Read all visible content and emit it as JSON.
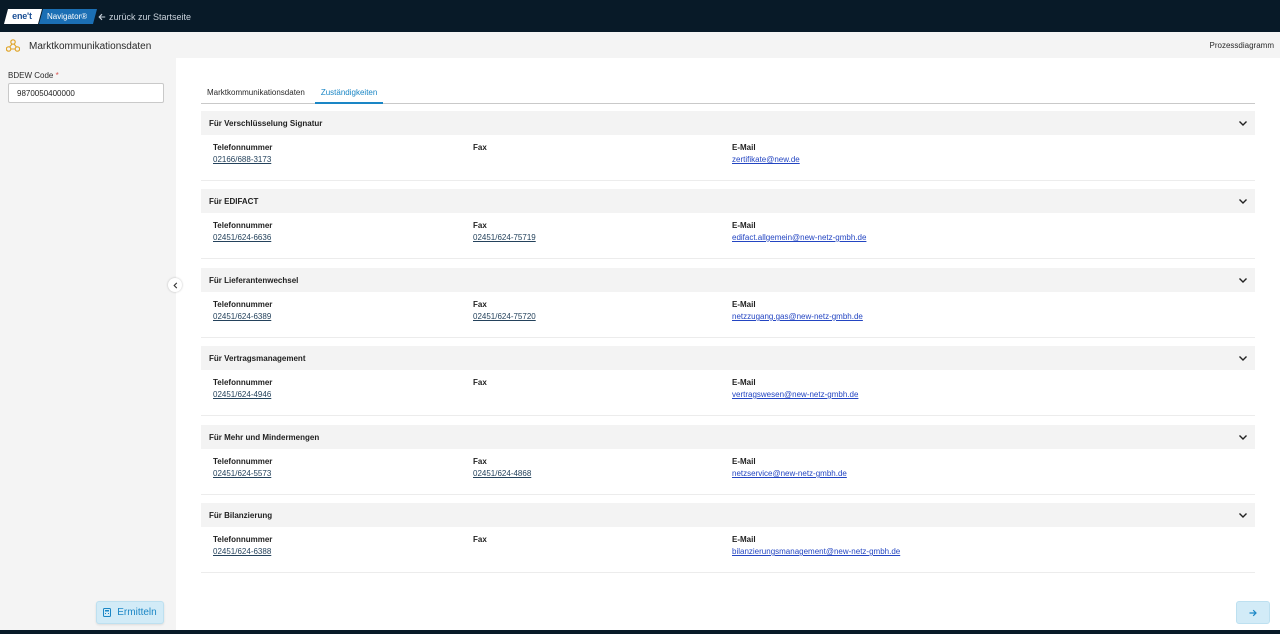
{
  "topbar": {
    "logo_left": "ene't",
    "logo_right": "Navigator®",
    "back_label": "zurück zur Startseite"
  },
  "header": {
    "title": "Marktkommunikationsdaten",
    "prozess_label": "Prozessdiagramm"
  },
  "sidebar": {
    "bdew_label": "BDEW Code",
    "required_mark": "*",
    "bdew_value": "9870050400000",
    "ermitteln_label": "Ermitteln"
  },
  "tabs": [
    {
      "label": "Marktkommunikationsdaten",
      "active": false
    },
    {
      "label": "Zuständigkeiten",
      "active": true
    }
  ],
  "labels": {
    "phone": "Telefonnummer",
    "fax": "Fax",
    "email": "E-Mail"
  },
  "sections": [
    {
      "title": "Für Verschlüsselung Signatur",
      "phone": "02166/688-3173",
      "fax": "",
      "email": "zertifikate@new.de"
    },
    {
      "title": "Für EDIFACT",
      "phone": "02451/624-6636",
      "fax": "02451/624-75719",
      "email": "edifact.allgemein@new-netz-gmbh.de"
    },
    {
      "title": "Für Lieferantenwechsel",
      "phone": "02451/624-6389",
      "fax": "02451/624-75720",
      "email": "netzzugang.gas@new-netz-gmbh.de"
    },
    {
      "title": "Für Vertragsmanagement",
      "phone": "02451/624-4946",
      "fax": "",
      "email": "vertragswesen@new-netz-gmbh.de"
    },
    {
      "title": "Für Mehr und Mindermengen",
      "phone": "02451/624-5573",
      "fax": "02451/624-4868",
      "email": "netzservice@new-netz-gmbh.de"
    },
    {
      "title": "Für Bilanzierung",
      "phone": "02451/624-6388",
      "fax": "",
      "email": "bilanzierungsmanagement@new-netz-gmbh.de"
    }
  ],
  "colors": {
    "topbar": "#081a28",
    "accent": "#1a86c5",
    "link": "#2345c2"
  }
}
